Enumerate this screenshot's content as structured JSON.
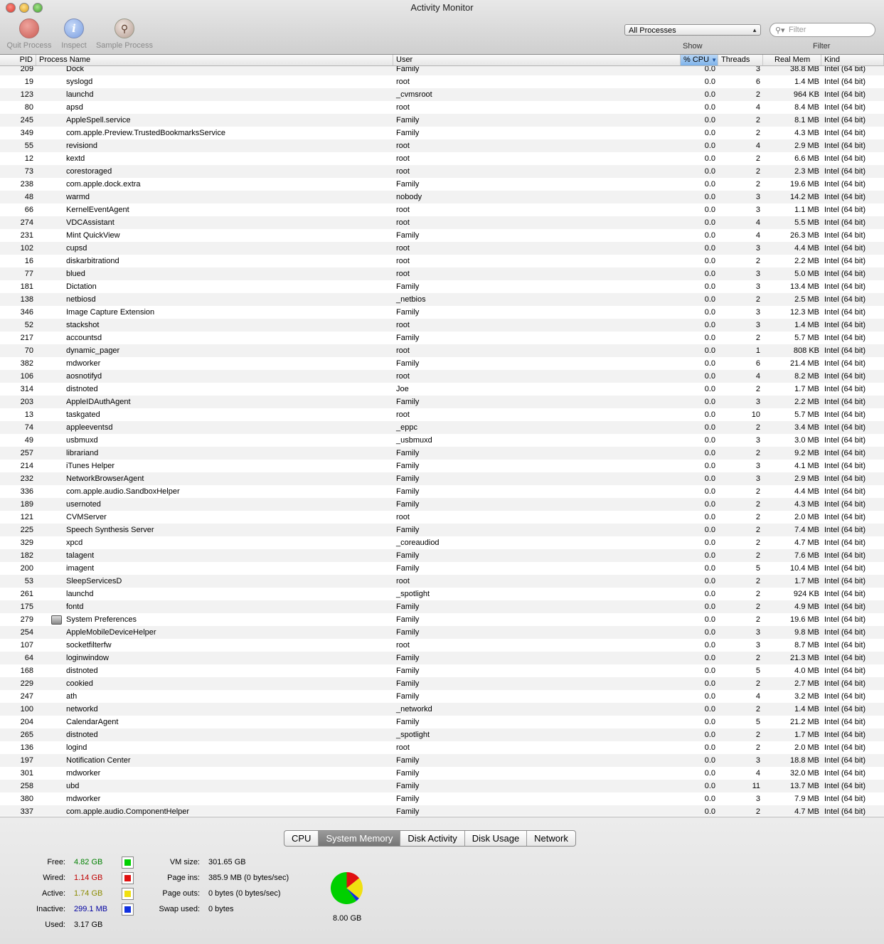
{
  "window": {
    "title": "Activity Monitor"
  },
  "toolbar": {
    "quit_label": "Quit Process",
    "inspect_label": "Inspect",
    "sample_label": "Sample Process",
    "show_label": "Show",
    "show_value": "All Processes",
    "filter_label": "Filter",
    "filter_placeholder": "Filter"
  },
  "columns": {
    "pid": "PID",
    "name": "Process Name",
    "user": "User",
    "cpu": "% CPU",
    "threads": "Threads",
    "mem": "Real Mem",
    "kind": "Kind"
  },
  "rows": [
    {
      "pid": "209",
      "name": "Dock",
      "user": "Family",
      "cpu": "0.0",
      "threads": "3",
      "mem": "38.8 MB",
      "kind": "Intel (64 bit)"
    },
    {
      "pid": "19",
      "name": "syslogd",
      "user": "root",
      "cpu": "0.0",
      "threads": "6",
      "mem": "1.4 MB",
      "kind": "Intel (64 bit)"
    },
    {
      "pid": "123",
      "name": "launchd",
      "user": "_cvmsroot",
      "cpu": "0.0",
      "threads": "2",
      "mem": "964 KB",
      "kind": "Intel (64 bit)"
    },
    {
      "pid": "80",
      "name": "apsd",
      "user": "root",
      "cpu": "0.0",
      "threads": "4",
      "mem": "8.4 MB",
      "kind": "Intel (64 bit)"
    },
    {
      "pid": "245",
      "name": "AppleSpell.service",
      "user": "Family",
      "cpu": "0.0",
      "threads": "2",
      "mem": "8.1 MB",
      "kind": "Intel (64 bit)"
    },
    {
      "pid": "349",
      "name": "com.apple.Preview.TrustedBookmarksService",
      "user": "Family",
      "cpu": "0.0",
      "threads": "2",
      "mem": "4.3 MB",
      "kind": "Intel (64 bit)"
    },
    {
      "pid": "55",
      "name": "revisiond",
      "user": "root",
      "cpu": "0.0",
      "threads": "4",
      "mem": "2.9 MB",
      "kind": "Intel (64 bit)"
    },
    {
      "pid": "12",
      "name": "kextd",
      "user": "root",
      "cpu": "0.0",
      "threads": "2",
      "mem": "6.6 MB",
      "kind": "Intel (64 bit)"
    },
    {
      "pid": "73",
      "name": "corestoraged",
      "user": "root",
      "cpu": "0.0",
      "threads": "2",
      "mem": "2.3 MB",
      "kind": "Intel (64 bit)"
    },
    {
      "pid": "238",
      "name": "com.apple.dock.extra",
      "user": "Family",
      "cpu": "0.0",
      "threads": "2",
      "mem": "19.6 MB",
      "kind": "Intel (64 bit)"
    },
    {
      "pid": "48",
      "name": "warmd",
      "user": "nobody",
      "cpu": "0.0",
      "threads": "3",
      "mem": "14.2 MB",
      "kind": "Intel (64 bit)"
    },
    {
      "pid": "66",
      "name": "KernelEventAgent",
      "user": "root",
      "cpu": "0.0",
      "threads": "3",
      "mem": "1.1 MB",
      "kind": "Intel (64 bit)"
    },
    {
      "pid": "274",
      "name": "VDCAssistant",
      "user": "root",
      "cpu": "0.0",
      "threads": "4",
      "mem": "5.5 MB",
      "kind": "Intel (64 bit)"
    },
    {
      "pid": "231",
      "name": "Mint QuickView",
      "user": "Family",
      "cpu": "0.0",
      "threads": "4",
      "mem": "26.3 MB",
      "kind": "Intel (64 bit)"
    },
    {
      "pid": "102",
      "name": "cupsd",
      "user": "root",
      "cpu": "0.0",
      "threads": "3",
      "mem": "4.4 MB",
      "kind": "Intel (64 bit)"
    },
    {
      "pid": "16",
      "name": "diskarbitrationd",
      "user": "root",
      "cpu": "0.0",
      "threads": "2",
      "mem": "2.2 MB",
      "kind": "Intel (64 bit)"
    },
    {
      "pid": "77",
      "name": "blued",
      "user": "root",
      "cpu": "0.0",
      "threads": "3",
      "mem": "5.0 MB",
      "kind": "Intel (64 bit)"
    },
    {
      "pid": "181",
      "name": "Dictation",
      "user": "Family",
      "cpu": "0.0",
      "threads": "3",
      "mem": "13.4 MB",
      "kind": "Intel (64 bit)"
    },
    {
      "pid": "138",
      "name": "netbiosd",
      "user": "_netbios",
      "cpu": "0.0",
      "threads": "2",
      "mem": "2.5 MB",
      "kind": "Intel (64 bit)"
    },
    {
      "pid": "346",
      "name": "Image Capture Extension",
      "user": "Family",
      "cpu": "0.0",
      "threads": "3",
      "mem": "12.3 MB",
      "kind": "Intel (64 bit)"
    },
    {
      "pid": "52",
      "name": "stackshot",
      "user": "root",
      "cpu": "0.0",
      "threads": "3",
      "mem": "1.4 MB",
      "kind": "Intel (64 bit)"
    },
    {
      "pid": "217",
      "name": "accountsd",
      "user": "Family",
      "cpu": "0.0",
      "threads": "2",
      "mem": "5.7 MB",
      "kind": "Intel (64 bit)"
    },
    {
      "pid": "70",
      "name": "dynamic_pager",
      "user": "root",
      "cpu": "0.0",
      "threads": "1",
      "mem": "808 KB",
      "kind": "Intel (64 bit)"
    },
    {
      "pid": "382",
      "name": "mdworker",
      "user": "Family",
      "cpu": "0.0",
      "threads": "6",
      "mem": "21.4 MB",
      "kind": "Intel (64 bit)"
    },
    {
      "pid": "106",
      "name": "aosnotifyd",
      "user": "root",
      "cpu": "0.0",
      "threads": "4",
      "mem": "8.2 MB",
      "kind": "Intel (64 bit)"
    },
    {
      "pid": "314",
      "name": "distnoted",
      "user": "Joe",
      "cpu": "0.0",
      "threads": "2",
      "mem": "1.7 MB",
      "kind": "Intel (64 bit)"
    },
    {
      "pid": "203",
      "name": "AppleIDAuthAgent",
      "user": "Family",
      "cpu": "0.0",
      "threads": "3",
      "mem": "2.2 MB",
      "kind": "Intel (64 bit)"
    },
    {
      "pid": "13",
      "name": "taskgated",
      "user": "root",
      "cpu": "0.0",
      "threads": "10",
      "mem": "5.7 MB",
      "kind": "Intel (64 bit)"
    },
    {
      "pid": "74",
      "name": "appleeventsd",
      "user": "_eppc",
      "cpu": "0.0",
      "threads": "2",
      "mem": "3.4 MB",
      "kind": "Intel (64 bit)"
    },
    {
      "pid": "49",
      "name": "usbmuxd",
      "user": "_usbmuxd",
      "cpu": "0.0",
      "threads": "3",
      "mem": "3.0 MB",
      "kind": "Intel (64 bit)"
    },
    {
      "pid": "257",
      "name": "librariand",
      "user": "Family",
      "cpu": "0.0",
      "threads": "2",
      "mem": "9.2 MB",
      "kind": "Intel (64 bit)"
    },
    {
      "pid": "214",
      "name": "iTunes Helper",
      "user": "Family",
      "cpu": "0.0",
      "threads": "3",
      "mem": "4.1 MB",
      "kind": "Intel (64 bit)"
    },
    {
      "pid": "232",
      "name": "NetworkBrowserAgent",
      "user": "Family",
      "cpu": "0.0",
      "threads": "3",
      "mem": "2.9 MB",
      "kind": "Intel (64 bit)"
    },
    {
      "pid": "336",
      "name": "com.apple.audio.SandboxHelper",
      "user": "Family",
      "cpu": "0.0",
      "threads": "2",
      "mem": "4.4 MB",
      "kind": "Intel (64 bit)"
    },
    {
      "pid": "189",
      "name": "usernoted",
      "user": "Family",
      "cpu": "0.0",
      "threads": "2",
      "mem": "4.3 MB",
      "kind": "Intel (64 bit)"
    },
    {
      "pid": "121",
      "name": "CVMServer",
      "user": "root",
      "cpu": "0.0",
      "threads": "2",
      "mem": "2.0 MB",
      "kind": "Intel (64 bit)"
    },
    {
      "pid": "225",
      "name": "Speech Synthesis Server",
      "user": "Family",
      "cpu": "0.0",
      "threads": "2",
      "mem": "7.4 MB",
      "kind": "Intel (64 bit)"
    },
    {
      "pid": "329",
      "name": "xpcd",
      "user": "_coreaudiod",
      "cpu": "0.0",
      "threads": "2",
      "mem": "4.7 MB",
      "kind": "Intel (64 bit)"
    },
    {
      "pid": "182",
      "name": "talagent",
      "user": "Family",
      "cpu": "0.0",
      "threads": "2",
      "mem": "7.6 MB",
      "kind": "Intel (64 bit)"
    },
    {
      "pid": "200",
      "name": "imagent",
      "user": "Family",
      "cpu": "0.0",
      "threads": "5",
      "mem": "10.4 MB",
      "kind": "Intel (64 bit)"
    },
    {
      "pid": "53",
      "name": "SleepServicesD",
      "user": "root",
      "cpu": "0.0",
      "threads": "2",
      "mem": "1.7 MB",
      "kind": "Intel (64 bit)"
    },
    {
      "pid": "261",
      "name": "launchd",
      "user": "_spotlight",
      "cpu": "0.0",
      "threads": "2",
      "mem": "924 KB",
      "kind": "Intel (64 bit)"
    },
    {
      "pid": "175",
      "name": "fontd",
      "user": "Family",
      "cpu": "0.0",
      "threads": "2",
      "mem": "4.9 MB",
      "kind": "Intel (64 bit)"
    },
    {
      "pid": "279",
      "name": "System Preferences",
      "user": "Family",
      "cpu": "0.0",
      "threads": "2",
      "mem": "19.6 MB",
      "kind": "Intel (64 bit)",
      "icon": "system-preferences-icon"
    },
    {
      "pid": "254",
      "name": "AppleMobileDeviceHelper",
      "user": "Family",
      "cpu": "0.0",
      "threads": "3",
      "mem": "9.8 MB",
      "kind": "Intel (64 bit)"
    },
    {
      "pid": "107",
      "name": "socketfilterfw",
      "user": "root",
      "cpu": "0.0",
      "threads": "3",
      "mem": "8.7 MB",
      "kind": "Intel (64 bit)"
    },
    {
      "pid": "64",
      "name": "loginwindow",
      "user": "Family",
      "cpu": "0.0",
      "threads": "2",
      "mem": "21.3 MB",
      "kind": "Intel (64 bit)"
    },
    {
      "pid": "168",
      "name": "distnoted",
      "user": "Family",
      "cpu": "0.0",
      "threads": "5",
      "mem": "4.0 MB",
      "kind": "Intel (64 bit)"
    },
    {
      "pid": "229",
      "name": "cookied",
      "user": "Family",
      "cpu": "0.0",
      "threads": "2",
      "mem": "2.7 MB",
      "kind": "Intel (64 bit)"
    },
    {
      "pid": "247",
      "name": "ath",
      "user": "Family",
      "cpu": "0.0",
      "threads": "4",
      "mem": "3.2 MB",
      "kind": "Intel (64 bit)"
    },
    {
      "pid": "100",
      "name": "networkd",
      "user": "_networkd",
      "cpu": "0.0",
      "threads": "2",
      "mem": "1.4 MB",
      "kind": "Intel (64 bit)"
    },
    {
      "pid": "204",
      "name": "CalendarAgent",
      "user": "Family",
      "cpu": "0.0",
      "threads": "5",
      "mem": "21.2 MB",
      "kind": "Intel (64 bit)"
    },
    {
      "pid": "265",
      "name": "distnoted",
      "user": "_spotlight",
      "cpu": "0.0",
      "threads": "2",
      "mem": "1.7 MB",
      "kind": "Intel (64 bit)"
    },
    {
      "pid": "136",
      "name": "logind",
      "user": "root",
      "cpu": "0.0",
      "threads": "2",
      "mem": "2.0 MB",
      "kind": "Intel (64 bit)"
    },
    {
      "pid": "197",
      "name": "Notification Center",
      "user": "Family",
      "cpu": "0.0",
      "threads": "3",
      "mem": "18.8 MB",
      "kind": "Intel (64 bit)"
    },
    {
      "pid": "301",
      "name": "mdworker",
      "user": "Family",
      "cpu": "0.0",
      "threads": "4",
      "mem": "32.0 MB",
      "kind": "Intel (64 bit)"
    },
    {
      "pid": "258",
      "name": "ubd",
      "user": "Family",
      "cpu": "0.0",
      "threads": "11",
      "mem": "13.7 MB",
      "kind": "Intel (64 bit)"
    },
    {
      "pid": "380",
      "name": "mdworker",
      "user": "Family",
      "cpu": "0.0",
      "threads": "3",
      "mem": "7.9 MB",
      "kind": "Intel (64 bit)"
    },
    {
      "pid": "337",
      "name": "com.apple.audio.ComponentHelper",
      "user": "Family",
      "cpu": "0.0",
      "threads": "2",
      "mem": "4.7 MB",
      "kind": "Intel (64 bit)"
    }
  ],
  "tabs": [
    "CPU",
    "System Memory",
    "Disk Activity",
    "Disk Usage",
    "Network"
  ],
  "active_tab": "System Memory",
  "memory": {
    "free_label": "Free:",
    "free": "4.82 GB",
    "wired_label": "Wired:",
    "wired": "1.14 GB",
    "active_label": "Active:",
    "active": "1.74 GB",
    "inactive_label": "Inactive:",
    "inactive": "299.1 MB",
    "used_label": "Used:",
    "used": "3.17 GB",
    "vm_label": "VM size:",
    "vm": "301.65 GB",
    "pageins_label": "Page ins:",
    "pageins": "385.9 MB (0 bytes/sec)",
    "pageouts_label": "Page outs:",
    "pageouts": "0 bytes (0 bytes/sec)",
    "swap_label": "Swap used:",
    "swap": "0 bytes",
    "total": "8.00 GB"
  },
  "colors": {
    "free": "#00d000",
    "wired": "#e01010",
    "active": "#f0e010",
    "inactive": "#1030e0",
    "free_text": "#008000",
    "wired_text": "#c00000",
    "active_text": "#8a8a00",
    "inactive_text": "#0000a0"
  }
}
